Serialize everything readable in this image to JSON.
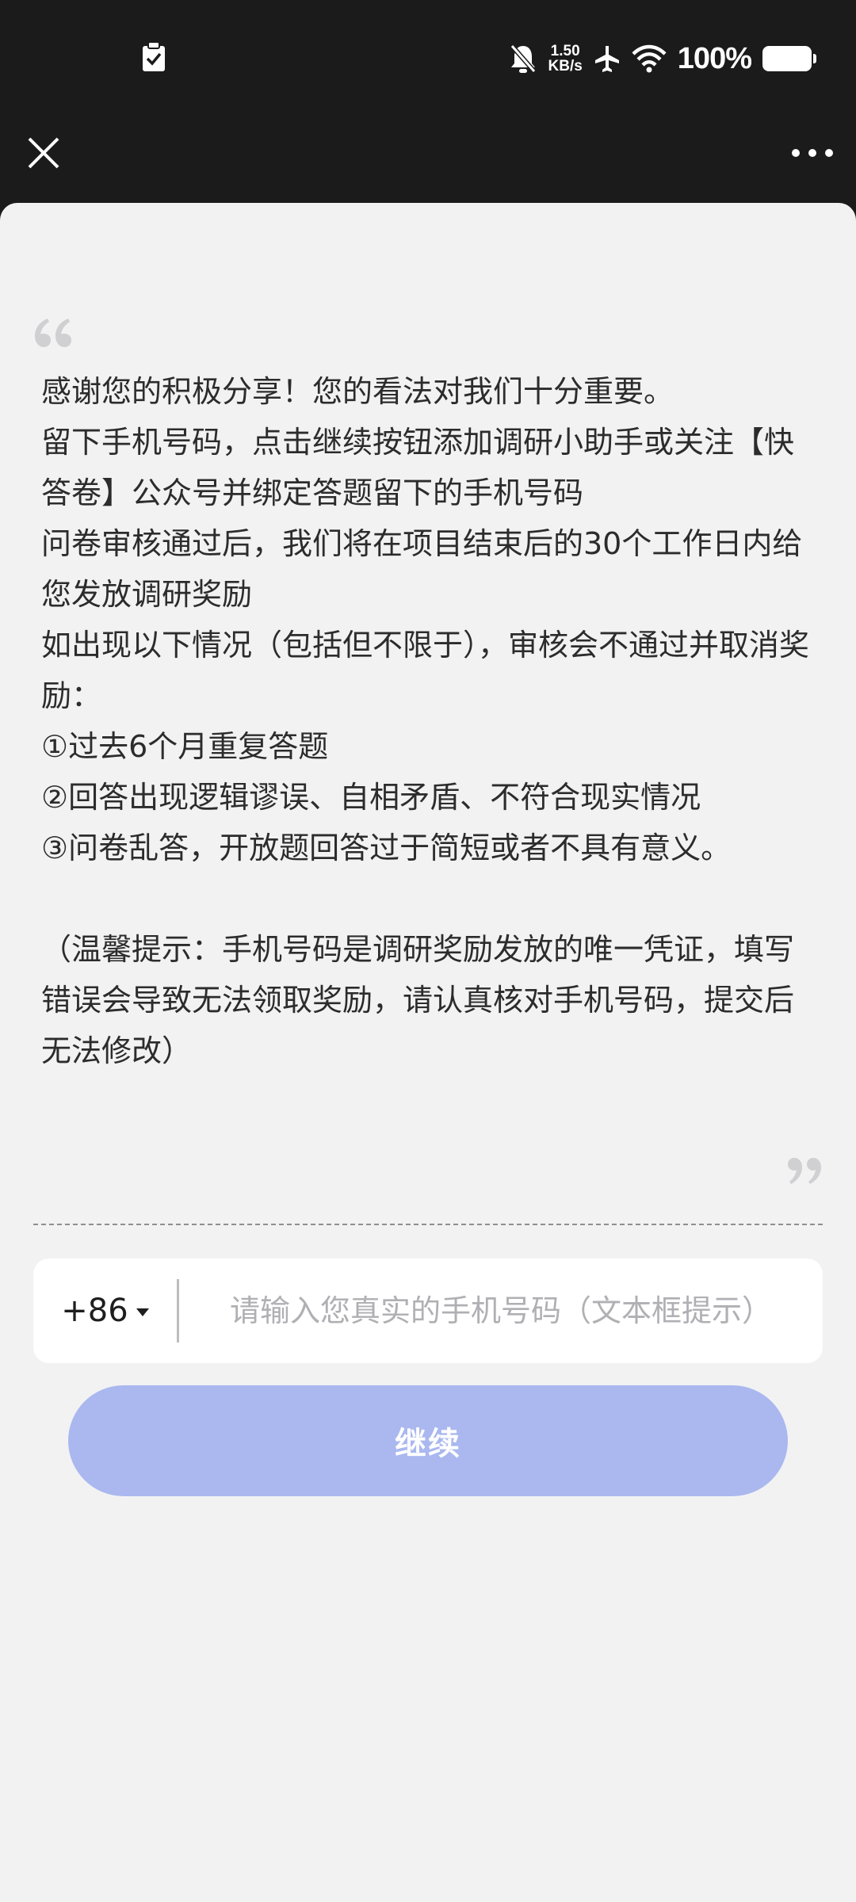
{
  "status_bar": {
    "clipboard_icon": "clipboard-check-icon",
    "network_speed_value": "1.50",
    "network_speed_unit": "KB/s",
    "battery_percent": "100%",
    "icons": [
      "bell-off-icon",
      "airplane-icon",
      "wifi-icon",
      "battery-icon"
    ]
  },
  "title_bar": {
    "close_icon": "close-icon",
    "more_icon": "more-horizontal-icon"
  },
  "message": {
    "lines": [
      "感谢您的积极分享！您的看法对我们十分重要。",
      "留下手机号码，点击继续按钮添加调研小助手或关注【快答卷】公众号并绑定答题留下的手机号码",
      "问卷审核通过后，我们将在项目结束后的30个工作日内给您发放调研奖励",
      "如出现以下情况（包括但不限于），审核会不通过并取消奖励：",
      "①过去6个月重复答题",
      "②回答出现逻辑谬误、自相矛盾、不符合现实情况",
      "③问卷乱答，开放题回答过于简短或者不具有意义。",
      "",
      "（温馨提示：手机号码是调研奖励发放的唯一凭证，填写错误会导致无法领取奖励，请认真核对手机号码，提交后无法修改）"
    ]
  },
  "phone": {
    "country_code": "+86",
    "value": "",
    "placeholder": "请输入您真实的手机号码（文本框提示）"
  },
  "continue_button": {
    "label": "继续",
    "color": "#aab8ef"
  },
  "colors": {
    "background": "#f2f2f3",
    "top_bar": "#1b1b1b",
    "text": "#2c2c2c",
    "quote": "#d0d0d3"
  }
}
